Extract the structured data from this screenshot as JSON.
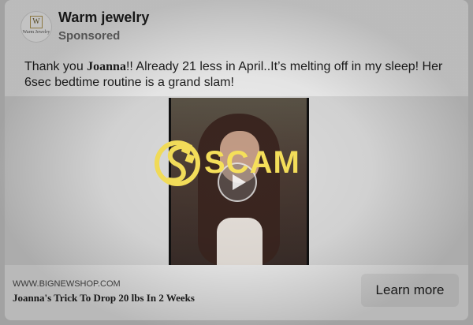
{
  "advertiser": {
    "name": "Warm jewelry",
    "label": "Sponsored",
    "avatar_monogram": "W",
    "avatar_text": "Warm Jewelry"
  },
  "post": {
    "text_before": "Thank you ",
    "text_bold": "Joanna",
    "text_after": "!! Already 21 less in April..It’s melting off in my sleep! Her 6sec bedtime routine is a grand slam!"
  },
  "media": {
    "play_icon": "play-icon"
  },
  "overlay": {
    "badge_text": "SCAM",
    "badge_color": "#f7e15b"
  },
  "link_preview": {
    "domain": "WWW.BIGNEWSHOP.COM",
    "headline": "Joanna's Trick To Drop 20 lbs In 2 Weeks",
    "cta_label": "Learn more"
  }
}
